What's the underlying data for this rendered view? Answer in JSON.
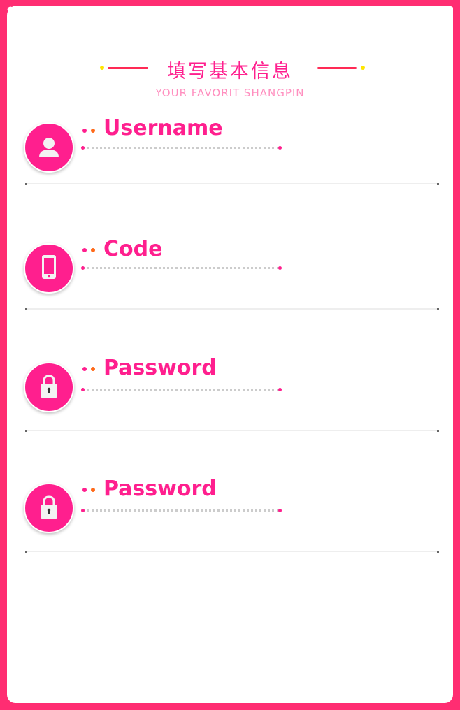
{
  "header": {
    "title": "填写基本信息",
    "subtitle": "YOUR FAVORIT SHANGPIN"
  },
  "colors": {
    "background": "#ff2d72",
    "accent": "#ff1f8e",
    "decor_line": "#ff2a55",
    "decor_dot": "#ffe600",
    "label_dot_orange": "#ff6a1a"
  },
  "fields": [
    {
      "label": "Username",
      "icon": "user-icon",
      "value": ""
    },
    {
      "label": "Code",
      "icon": "phone-icon",
      "value": ""
    },
    {
      "label": "Password",
      "icon": "lock-icon",
      "value": ""
    },
    {
      "label": "Password",
      "icon": "lock-icon",
      "value": ""
    }
  ]
}
